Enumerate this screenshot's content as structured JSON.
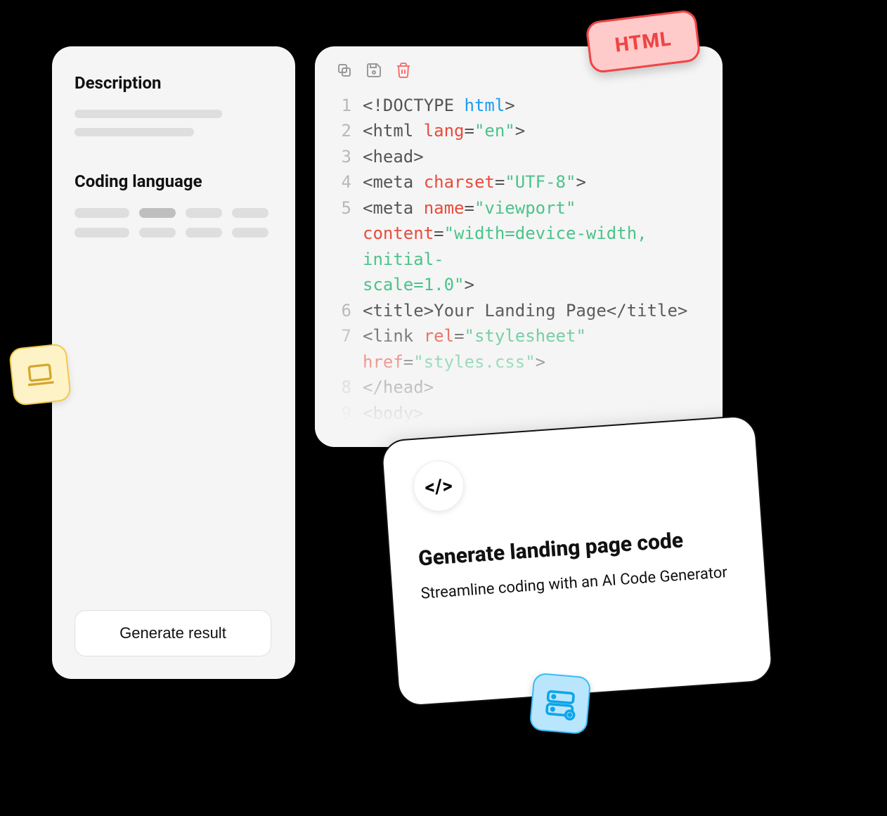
{
  "left": {
    "description_title": "Description",
    "language_title": "Coding language",
    "generate_button": "Generate result"
  },
  "badge": {
    "label": "HTML"
  },
  "toolbar": {
    "copy": "copy",
    "save": "save",
    "delete": "delete"
  },
  "code": {
    "lines": [
      {
        "n": "1",
        "seg": [
          [
            "<!DOCTYPE ",
            "gray"
          ],
          [
            "html",
            "blue"
          ],
          [
            ">",
            "gray"
          ]
        ]
      },
      {
        "n": "2",
        "seg": [
          [
            "<html ",
            "gray"
          ],
          [
            "lang",
            "red"
          ],
          [
            "=",
            "gray"
          ],
          [
            "\"en\"",
            "green"
          ],
          [
            ">",
            "gray"
          ]
        ]
      },
      {
        "n": "3",
        "seg": [
          [
            "<head>",
            "gray"
          ]
        ]
      },
      {
        "n": "4",
        "seg": [
          [
            "    <meta ",
            "gray"
          ],
          [
            "charset",
            "red"
          ],
          [
            "=",
            "gray"
          ],
          [
            "\"UTF-8\"",
            "green"
          ],
          [
            ">",
            "gray"
          ]
        ]
      },
      {
        "n": "5",
        "seg": [
          [
            "    <meta ",
            "gray"
          ],
          [
            "name",
            "red"
          ],
          [
            "=",
            "gray"
          ],
          [
            "\"viewport\" ",
            "green"
          ]
        ]
      },
      {
        "n": "",
        "seg": [
          [
            "content",
            "red"
          ],
          [
            "=",
            "gray"
          ],
          [
            "\"width=device-width, initial-",
            "green"
          ]
        ]
      },
      {
        "n": "",
        "seg": [
          [
            "scale=1.0\"",
            "green"
          ],
          [
            ">",
            "gray"
          ]
        ]
      },
      {
        "n": "6",
        "seg": [
          [
            "    <title>Your Landing Page</title>",
            "gray"
          ]
        ]
      },
      {
        "n": "7",
        "seg": [
          [
            "    <link ",
            "gray"
          ],
          [
            "rel",
            "red"
          ],
          [
            "=",
            "gray"
          ],
          [
            "\"stylesheet\" ",
            "green"
          ]
        ]
      },
      {
        "n": "",
        "seg": [
          [
            "href",
            "red"
          ],
          [
            "=",
            "gray"
          ],
          [
            "\"styles.css\"",
            "green"
          ],
          [
            ">",
            "gray"
          ]
        ]
      },
      {
        "n": "8",
        "seg": [
          [
            "</head>",
            "gray"
          ]
        ]
      },
      {
        "n": "9",
        "seg": [
          [
            "<body>",
            "gray"
          ]
        ]
      }
    ]
  },
  "feature": {
    "icon": "</>",
    "title": "Generate landing page code",
    "subtitle": "Streamline coding with an AI Code Generator"
  },
  "icons": {
    "laptop": "laptop",
    "server": "server"
  }
}
